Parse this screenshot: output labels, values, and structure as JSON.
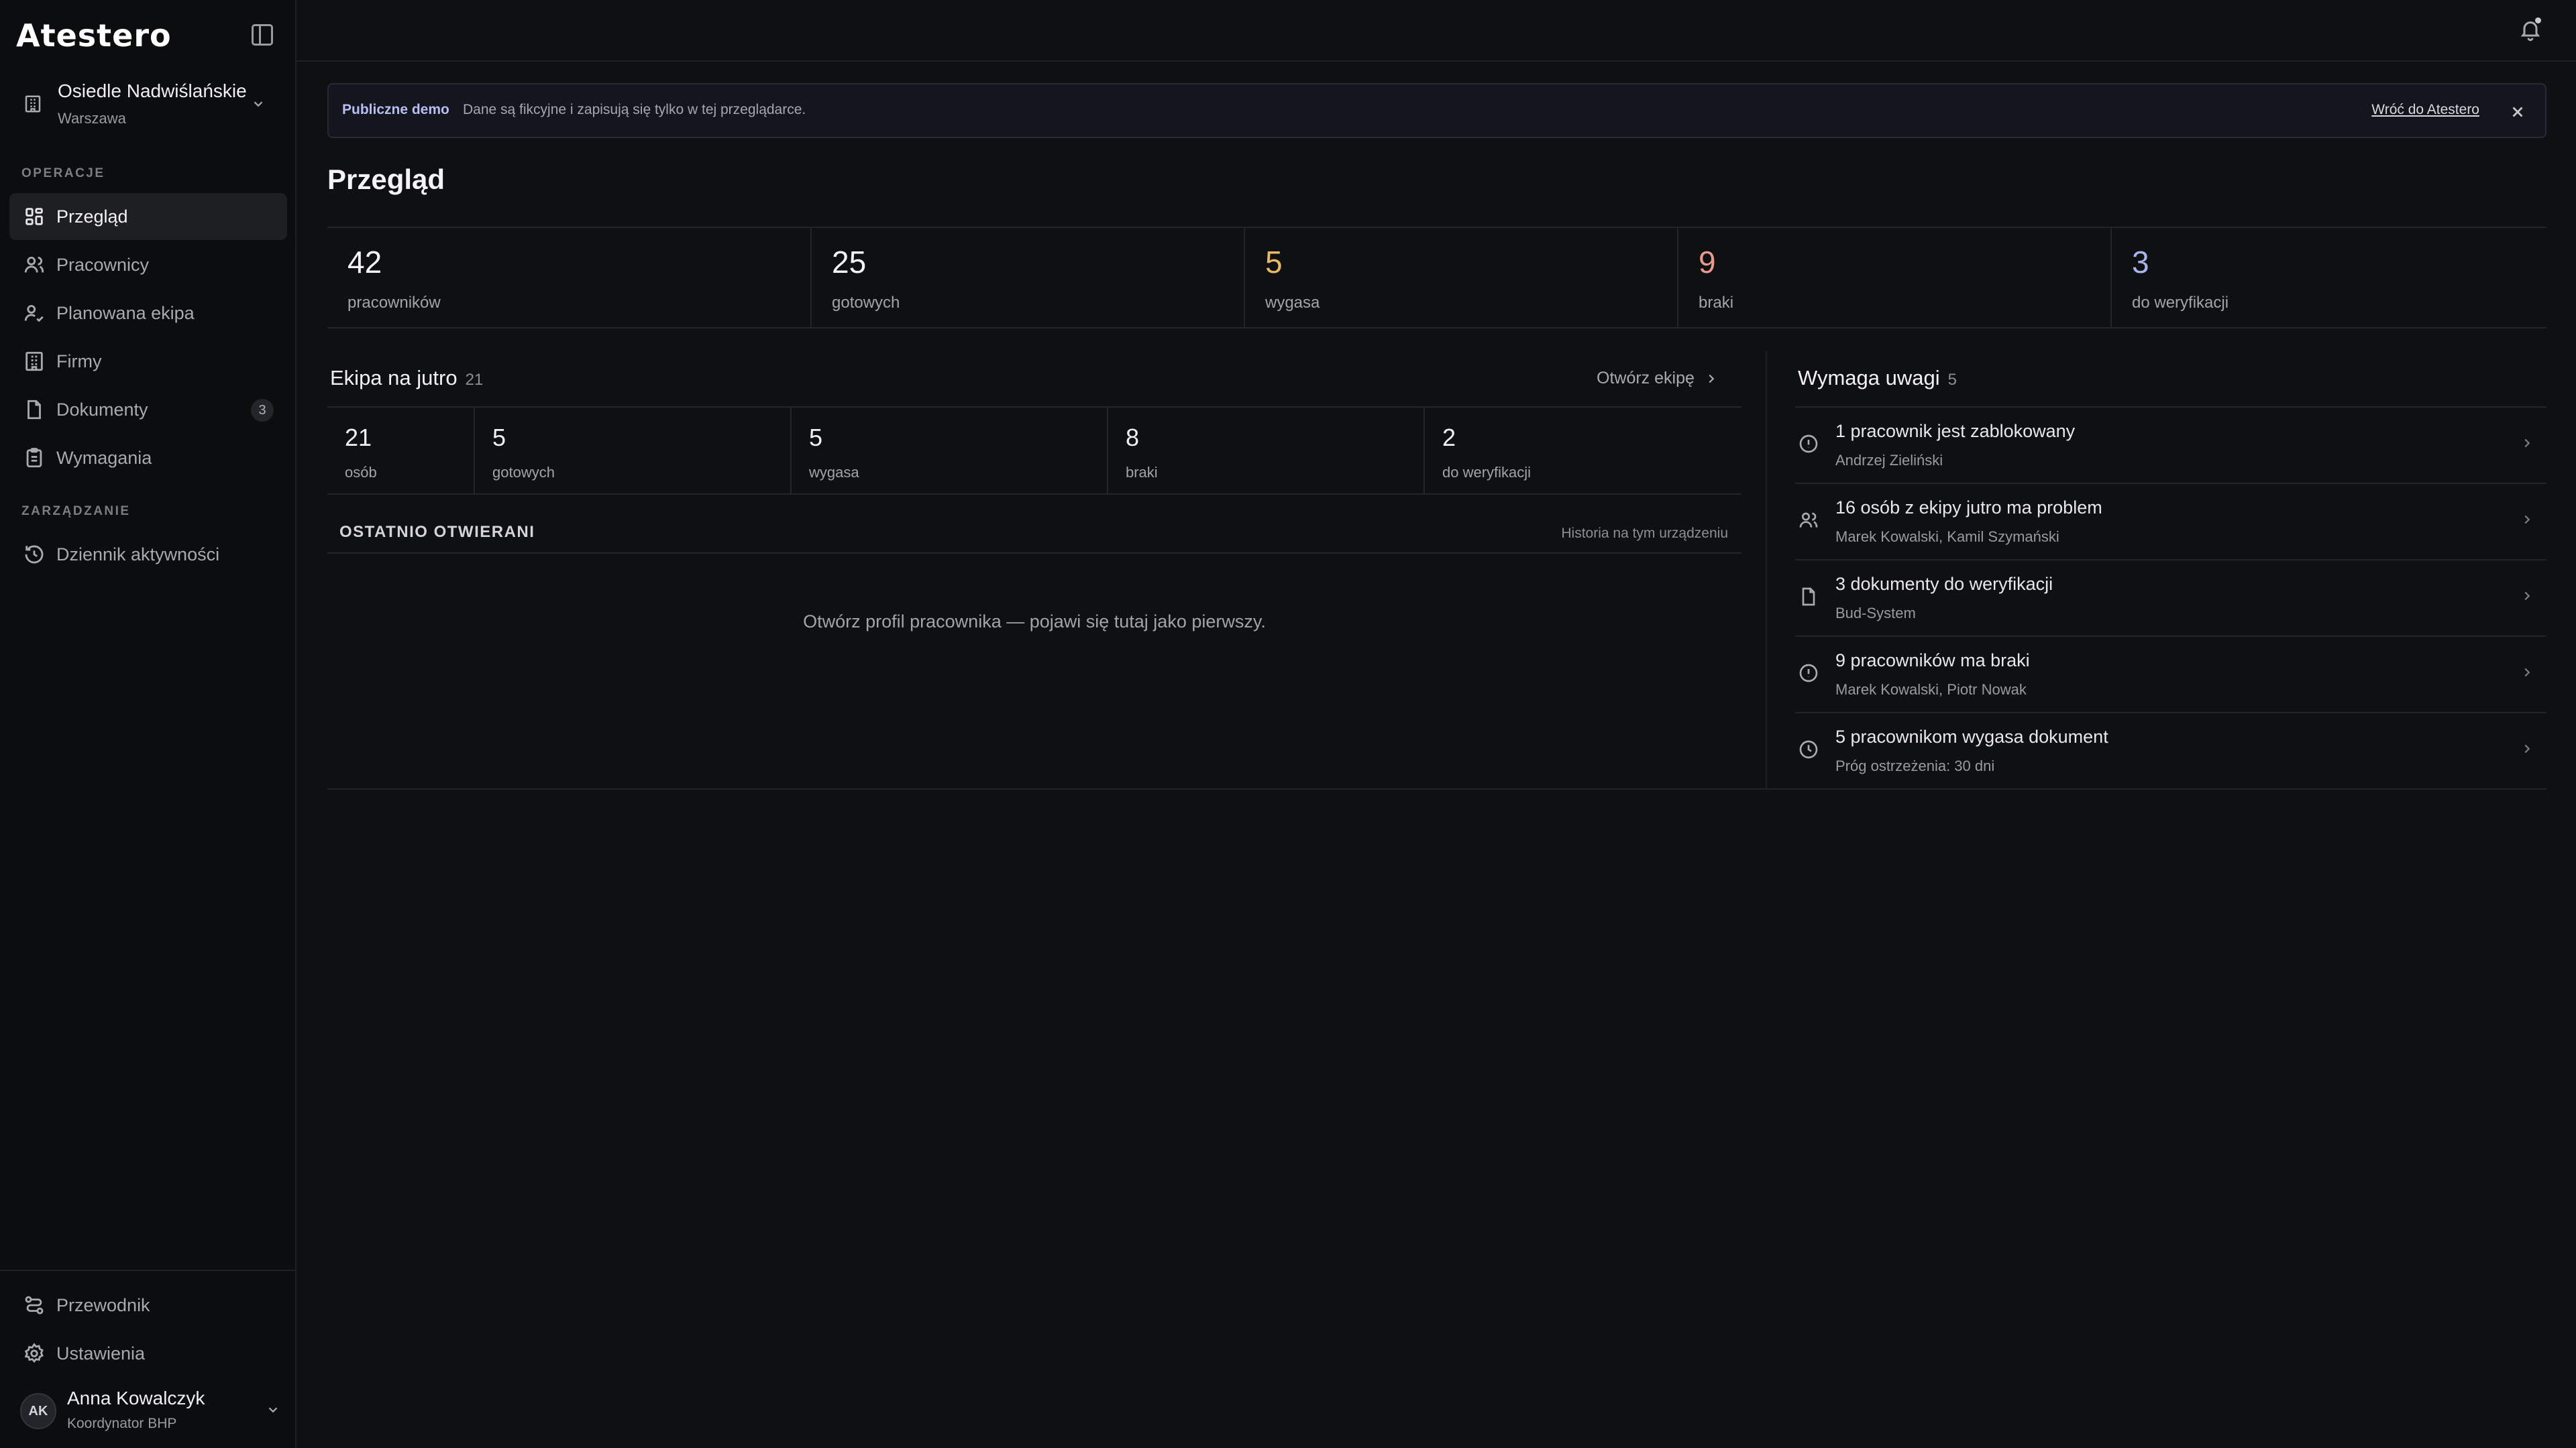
{
  "app": {
    "logo": "Atestero"
  },
  "org": {
    "name": "Osiedle Nadwiślańskie",
    "city": "Warszawa"
  },
  "nav": {
    "section_ops": "OPERACJE",
    "section_mgmt": "ZARZĄDZANIE",
    "items": [
      {
        "label": "Przegląd",
        "icon": "grid-icon"
      },
      {
        "label": "Pracownicy",
        "icon": "users-icon"
      },
      {
        "label": "Planowana ekipa",
        "icon": "user-check-icon"
      },
      {
        "label": "Firmy",
        "icon": "building-icon"
      },
      {
        "label": "Dokumenty",
        "icon": "document-icon",
        "count": "3"
      },
      {
        "label": "Wymagania",
        "icon": "clipboard-icon"
      },
      {
        "label": "Dziennik aktywności",
        "icon": "history-icon"
      }
    ],
    "bottom": [
      {
        "label": "Przewodnik",
        "icon": "route-icon"
      },
      {
        "label": "Ustawienia",
        "icon": "gear-icon"
      }
    ]
  },
  "user": {
    "initials": "AK",
    "name": "Anna Kowalczyk",
    "role": "Koordynator BHP"
  },
  "banner": {
    "tag": "Publiczne demo",
    "text": "Dane są fikcyjne i zapisują się tylko w tej przeglądarce.",
    "link": "Wróć do Atestero"
  },
  "page": {
    "title": "Przegląd"
  },
  "stats": [
    {
      "value": "42",
      "label": "pracowników",
      "color": "#f4f4f6"
    },
    {
      "value": "25",
      "label": "gotowych",
      "color": "#f4f4f6"
    },
    {
      "value": "5",
      "label": "wygasa",
      "color": "#e8b86a"
    },
    {
      "value": "9",
      "label": "braki",
      "color": "#e89a8f"
    },
    {
      "value": "3",
      "label": "do weryfikacji",
      "color": "#a9b3f0"
    }
  ],
  "crew": {
    "title": "Ekipa na jutro",
    "count": "21",
    "open_label": "Otwórz ekipę",
    "stats": [
      {
        "value": "21",
        "label": "osób"
      },
      {
        "value": "5",
        "label": "gotowych"
      },
      {
        "value": "5",
        "label": "wygasa"
      },
      {
        "value": "8",
        "label": "braki"
      },
      {
        "value": "2",
        "label": "do weryfikacji"
      }
    ]
  },
  "recent": {
    "title": "OSTATNIO OTWIERANI",
    "note": "Historia na tym urządzeniu",
    "empty": "Otwórz profil pracownika — pojawi się tutaj jako pierwszy."
  },
  "attention": {
    "title": "Wymaga uwagi",
    "count": "5",
    "items": [
      {
        "title": "1 pracownik jest zablokowany",
        "sub": "Andrzej Zieliński",
        "icon": "alert-circle-icon"
      },
      {
        "title": "16 osób z ekipy jutro ma problem",
        "sub": "Marek Kowalski, Kamil Szymański",
        "icon": "users-icon"
      },
      {
        "title": "3 dokumenty do weryfikacji",
        "sub": "Bud-System",
        "icon": "document-icon"
      },
      {
        "title": "9 pracowników ma braki",
        "sub": "Marek Kowalski, Piotr Nowak",
        "icon": "alert-circle-icon"
      },
      {
        "title": "5 pracownikom wygasa dokument",
        "sub": "Próg ostrzeżenia: 30 dni",
        "icon": "clock-icon"
      }
    ]
  }
}
